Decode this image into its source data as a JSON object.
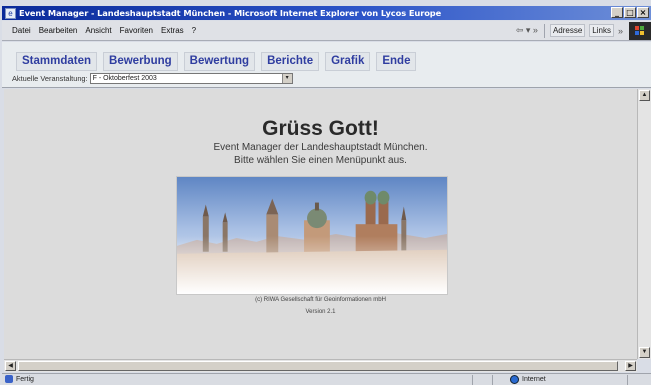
{
  "window": {
    "title": "Event Manager - Landeshauptstadt München - Microsoft Internet Explorer von Lycos Europe",
    "app_icon": "e",
    "buttons": [
      {
        "name": "minimize-button",
        "glyph": "_"
      },
      {
        "name": "maximize-button",
        "glyph": "□"
      },
      {
        "name": "close-button",
        "glyph": "×"
      }
    ]
  },
  "menubar": {
    "items": [
      "Datei",
      "Bearbeiten",
      "Ansicht",
      "Favoriten",
      "Extras",
      "?"
    ],
    "nav_glyph": "⇦ ▾ »",
    "address_label": "Adresse",
    "links_label": "Links",
    "more_glyph": "»"
  },
  "nav": {
    "buttons": [
      "Stammdaten",
      "Bewerbung",
      "Bewertung",
      "Berichte",
      "Grafik",
      "Ende"
    ],
    "event_label": "Aktuelle Veranstaltung:",
    "event_value": "F - Oktoberfest 2003",
    "dropdown_arrow": "▾"
  },
  "main": {
    "greeting": "Grüss Gott!",
    "subtitle_line1": "Event Manager der Landeshauptstadt München.",
    "subtitle_line2": "Bitte wählen Sie einen Menüpunkt aus.",
    "copyright": "(c) RIWA Gesellschaft für Geoinformationen mbH",
    "version": "Version 2.1"
  },
  "scrollbars": {
    "up": "▲",
    "down": "▼",
    "left": "◀",
    "right": "▶"
  },
  "status": {
    "left_text": "Fertig",
    "zone_text": "Internet"
  },
  "colors": {
    "nav_text": "#2f3da0",
    "title_bar": "#0a2a9a",
    "content_bg": "#dcdcdc"
  },
  "icons": {
    "app": "ie-icon",
    "status": "page-icon",
    "zone": "globe-icon"
  }
}
